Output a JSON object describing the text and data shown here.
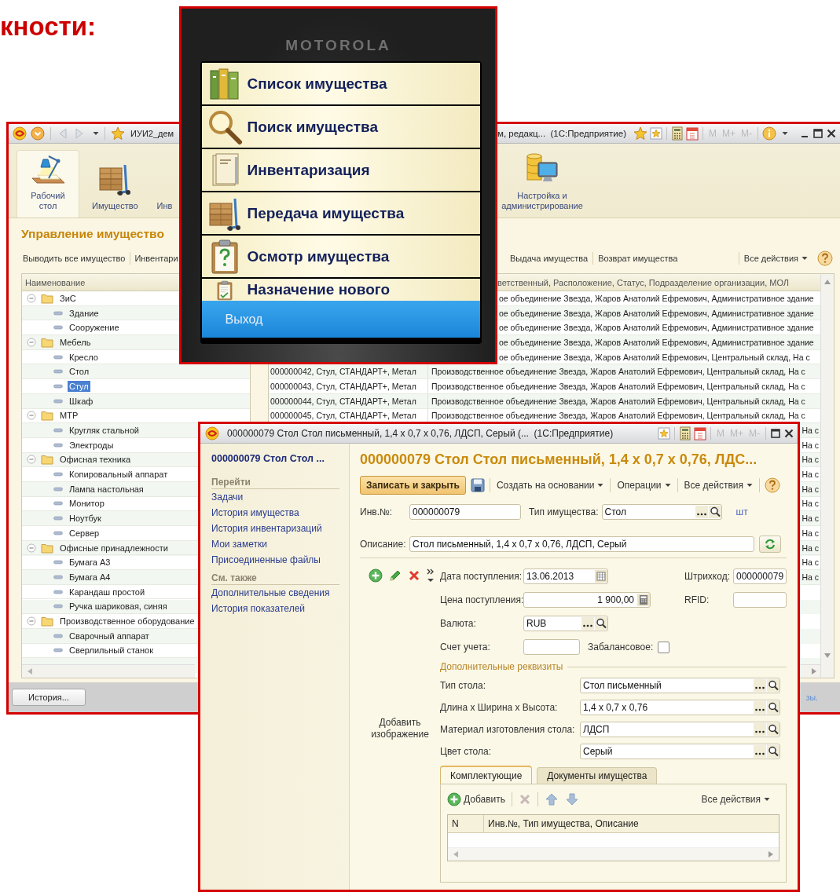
{
  "slide_heading": "кности:",
  "main_window": {
    "title_left": "ИУИ2_дем",
    "title_right": "м, редакц...  (1С:Предприятие)",
    "mem_buttons": [
      "M",
      "M+",
      "M-"
    ],
    "sections_left": [
      {
        "label": "Рабочий стол",
        "selected": true
      },
      {
        "label": "Имущество",
        "selected": false
      },
      {
        "label": "Инв",
        "selected": false
      }
    ],
    "sections_right": [
      {
        "label": "Настройка и администрирование",
        "selected": false
      }
    ],
    "heading": "Управление имуществo",
    "commands_left": [
      "Выводить все имущество",
      "Инвентари"
    ],
    "commands_right": [
      "Выдача имущества",
      "Возврат имущества"
    ],
    "all_actions": "Все действия",
    "tree": {
      "column": "Наименование",
      "items": [
        {
          "label": "ЗиС",
          "expanded": true,
          "selected": false,
          "children": [
            {
              "label": "Здание",
              "selected": false
            },
            {
              "label": "Сооружение",
              "selected": false
            }
          ]
        },
        {
          "label": "Мебель",
          "expanded": true,
          "selected": false,
          "children": [
            {
              "label": "Кресло",
              "selected": false
            },
            {
              "label": "Стол",
              "selected": false
            },
            {
              "label": "Стул",
              "selected": true
            },
            {
              "label": "Шкаф",
              "selected": false
            }
          ]
        },
        {
          "label": "МТР",
          "expanded": true,
          "selected": false,
          "children": [
            {
              "label": "Кругляк стальной",
              "selected": false
            },
            {
              "label": "Электроды",
              "selected": false
            }
          ]
        },
        {
          "label": "Офисная техника",
          "expanded": true,
          "selected": false,
          "children": [
            {
              "label": "Копировальный аппарат",
              "selected": false
            },
            {
              "label": "Лампа настольная",
              "selected": false
            },
            {
              "label": "Монитор",
              "selected": false
            },
            {
              "label": "Ноутбук",
              "selected": false
            },
            {
              "label": "Сервер",
              "selected": false
            }
          ]
        },
        {
          "label": "Офисные принадлежности",
          "expanded": true,
          "selected": false,
          "children": [
            {
              "label": "Бумага А3",
              "selected": false
            },
            {
              "label": "Бумага А4",
              "selected": false
            },
            {
              "label": "Карандаш простой",
              "selected": false
            },
            {
              "label": "Ручка шариковая, синяя",
              "selected": false
            }
          ]
        },
        {
          "label": "Производственное оборудование",
          "expanded": true,
          "selected": false,
          "children": [
            {
              "label": "Сварочный аппарат",
              "selected": false
            },
            {
              "label": "Сверлильный станок",
              "selected": false
            }
          ]
        }
      ]
    },
    "list": {
      "header": "ветственный, Расположение, Статус, Подразделение организации, МОЛ",
      "rows": [
        {
          "kind": "tail_phone",
          "cells": [
            "ое объединение Звезда, Жаров Анатолий Ефремович, Административное здание"
          ]
        },
        {
          "kind": "tail_phone",
          "cells": [
            "ое объединение Звезда, Жаров Анатолий Ефремович, Административное здание"
          ]
        },
        {
          "kind": "tail_phone",
          "cells": [
            "ое объединение Звезда, Жаров Анатолий Ефремович, Административное здание"
          ]
        },
        {
          "kind": "tail_phone",
          "cells": [
            "ое объединение Звезда, Жаров Анатолий Ефремович, Административное здание"
          ]
        },
        {
          "kind": "tail_phone",
          "cells": [
            "ое объединение Звезда, Жаров Анатолий Ефремович, Центральный склад, На с"
          ]
        },
        {
          "kind": "full",
          "cells": [
            "000000042, Стул, СТАНДАРТ+, Метал",
            "Производственное объединение Звезда, Жаров Анатолий Ефремович, Центральный склад, На с"
          ]
        },
        {
          "kind": "full",
          "cells": [
            "000000043, Стул, СТАНДАРТ+, Метал",
            "Производственное объединение Звезда, Жаров Анатолий Ефремович, Центральный склад, На с"
          ]
        },
        {
          "kind": "full",
          "cells": [
            "000000044, Стул, СТАНДАРТ+, Метал",
            "Производственное объединение Звезда, Жаров Анатолий Ефремович, Центральный склад, На с"
          ]
        },
        {
          "kind": "full",
          "cells": [
            "000000045, Стул, СТАНДАРТ+, Метал",
            "Производственное объединение Звезда, Жаров Анатолий Ефремович, Центральный склад, На с"
          ]
        },
        {
          "kind": "tail_form",
          "cells": [
            "На с"
          ]
        },
        {
          "kind": "tail_form",
          "cells": [
            "На с"
          ]
        },
        {
          "kind": "tail_form",
          "cells": [
            "На с"
          ]
        },
        {
          "kind": "tail_form",
          "cells": [
            "На с"
          ]
        },
        {
          "kind": "tail_form",
          "cells": [
            "На с"
          ]
        },
        {
          "kind": "tail_form",
          "cells": [
            "На с"
          ]
        },
        {
          "kind": "tail_form",
          "cells": [
            "На с"
          ]
        },
        {
          "kind": "tail_form",
          "cells": [
            "На с"
          ]
        },
        {
          "kind": "tail_form",
          "cells": [
            "На с"
          ]
        },
        {
          "kind": "tail_form",
          "cells": [
            "На с"
          ]
        },
        {
          "kind": "tail_form",
          "cells": [
            "На с"
          ]
        }
      ]
    },
    "history_button": "История...",
    "status_link": "зы."
  },
  "phone": {
    "brand": "MOTOROLA",
    "menu": [
      {
        "label": "Список имущества"
      },
      {
        "label": "Поиск имущества"
      },
      {
        "label": "Инвентаризация"
      },
      {
        "label": "Передача имущества"
      },
      {
        "label": "Осмотр имущества"
      },
      {
        "label": "Назначение нового"
      }
    ],
    "exit": "Выход"
  },
  "form_window": {
    "title": "000000079 Стол Стол письменный, 1,4 x 0,7 x 0,76, ЛДСП, Серый (...  (1С:Предприятие)",
    "mem_buttons": [
      "M",
      "M+",
      "M-"
    ],
    "nav": {
      "heading": "000000079 Стол Стол ...",
      "groups": [
        {
          "title": "Перейти",
          "links": [
            "Задачи",
            "История имущества",
            "История инвентаризаций",
            "Мои заметки",
            "Присоединенные файлы"
          ]
        },
        {
          "title": "См. также",
          "links": [
            "Дополнительные сведения",
            "История показателей"
          ]
        }
      ]
    },
    "header": "000000079 Стол Стол письменный, 1,4 x 0,7 x 0,76, ЛДС...",
    "toolbar": {
      "primary": "Записать и закрыть",
      "menus": [
        "Создать на основании",
        "Операции",
        "Все действия"
      ]
    },
    "inv_no": {
      "label": "Инв.№:",
      "value": "000000079"
    },
    "asset_type": {
      "label": "Тип имущества:",
      "value": "Стол",
      "unit": "шт"
    },
    "description": {
      "label": "Описание:",
      "value": "Стол письменный, 1,4 x 0,7 x 0,76, ЛДСП, Серый"
    },
    "receipt_date": {
      "label": "Дата поступления:",
      "value": "13.06.2013"
    },
    "barcode": {
      "label": "Штрихкод:",
      "value": "000000079"
    },
    "price": {
      "label": "Цена поступления:",
      "value": "1 900,00"
    },
    "rfid": {
      "label": "RFID:"
    },
    "currency": {
      "label": "Валюта:",
      "value": "RUB"
    },
    "account": {
      "label": "Счет учета:"
    },
    "off_balance": {
      "label": "Забалансовое:",
      "checked": false
    },
    "image_placeholder": "Добавить изображение",
    "extra_group": {
      "title": "Дополнительные реквизиты",
      "fields": [
        {
          "label": "Тип стола:",
          "value": "Стол письменный"
        },
        {
          "label": "Длина х Ширина х Высота:",
          "value": "1,4 x 0,7 x 0,76"
        },
        {
          "label": "Материал изготовления стола:",
          "value": "ЛДСП"
        },
        {
          "label": "Цвет стола:",
          "value": "Серый"
        }
      ]
    },
    "tabs": [
      {
        "label": "Комплектующие",
        "selected": true
      },
      {
        "label": "Документы имущества",
        "selected": false
      }
    ],
    "tab_toolbar": {
      "add": "Добавить",
      "all_actions": "Все действия"
    },
    "table": {
      "columns": [
        "N",
        "Инв.№, Тип имущества, Описание"
      ]
    }
  }
}
